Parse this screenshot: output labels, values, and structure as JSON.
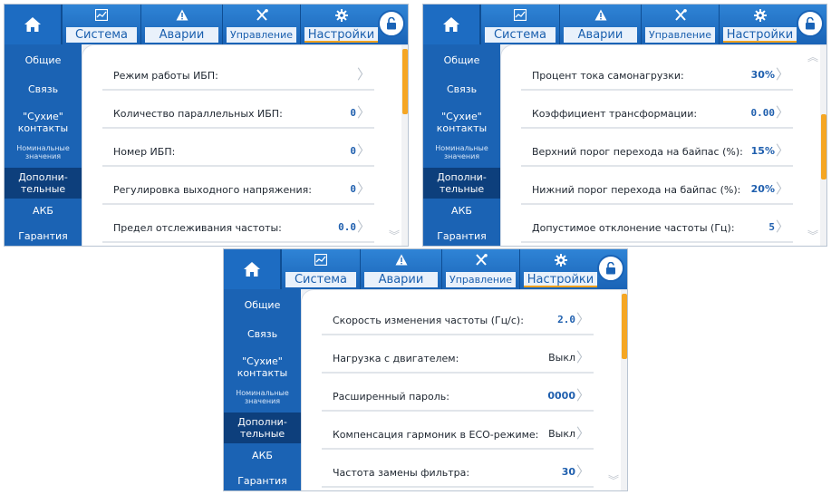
{
  "topbar": {
    "home_icon": "home-icon",
    "tabs": [
      {
        "label": "Система",
        "icon": "chart-icon"
      },
      {
        "label": "Аварии",
        "icon": "warning-icon"
      },
      {
        "label": "Управление",
        "icon": "tools-icon"
      },
      {
        "label": "Настройки",
        "icon": "gear-icon"
      }
    ],
    "lock_icon": "unlock-icon"
  },
  "sidebar": {
    "items": [
      {
        "line1": "Общие",
        "line2": ""
      },
      {
        "line1": "Связь",
        "line2": ""
      },
      {
        "line1": "\"Сухие\"",
        "line2": "контакты"
      },
      {
        "line1": "Номинальные",
        "line2": "значения"
      },
      {
        "line1": "Дополни-",
        "line2": "тельные"
      },
      {
        "line1": "АКБ",
        "line2": ""
      },
      {
        "line1": "Гарантия",
        "line2": ""
      }
    ]
  },
  "colors": {
    "accent": "#f5a623",
    "header": "#1a63b6",
    "value": "#1f5fae"
  },
  "panels": [
    {
      "rows": [
        {
          "label": "Режим работы ИБП:",
          "value": ""
        },
        {
          "label": "Количество параллельных ИБП:",
          "value": "0"
        },
        {
          "label": "Номер ИБП:",
          "value": "0"
        },
        {
          "label": "Регулировка выходного напряжения:",
          "value": "0"
        },
        {
          "label": "Предел отслеживания частоты:",
          "value": "0.0"
        }
      ]
    },
    {
      "rows": [
        {
          "label": "Процент тока самонагрузки:",
          "value": "30%"
        },
        {
          "label": "Коэффициент трансформации:",
          "value": "0.00"
        },
        {
          "label": "Верхний порог перехода на байпас (%):",
          "value": "15%"
        },
        {
          "label": "Нижний порог перехода на байпас (%):",
          "value": "20%"
        },
        {
          "label": "Допустимое отклонение частоты (Гц):",
          "value": "5"
        }
      ]
    },
    {
      "rows": [
        {
          "label": "Скорость изменения частоты (Гц/с):",
          "value": "2.0"
        },
        {
          "label": "Нагрузка с двигателем:",
          "value": "Выкл"
        },
        {
          "label": "Расширенный пароль:",
          "value": "0000"
        },
        {
          "label": "Компенсация гармоник в ЕСО-режиме:",
          "value": "Выкл"
        },
        {
          "label": "Частота замены фильтра:",
          "value": "30"
        }
      ]
    }
  ]
}
